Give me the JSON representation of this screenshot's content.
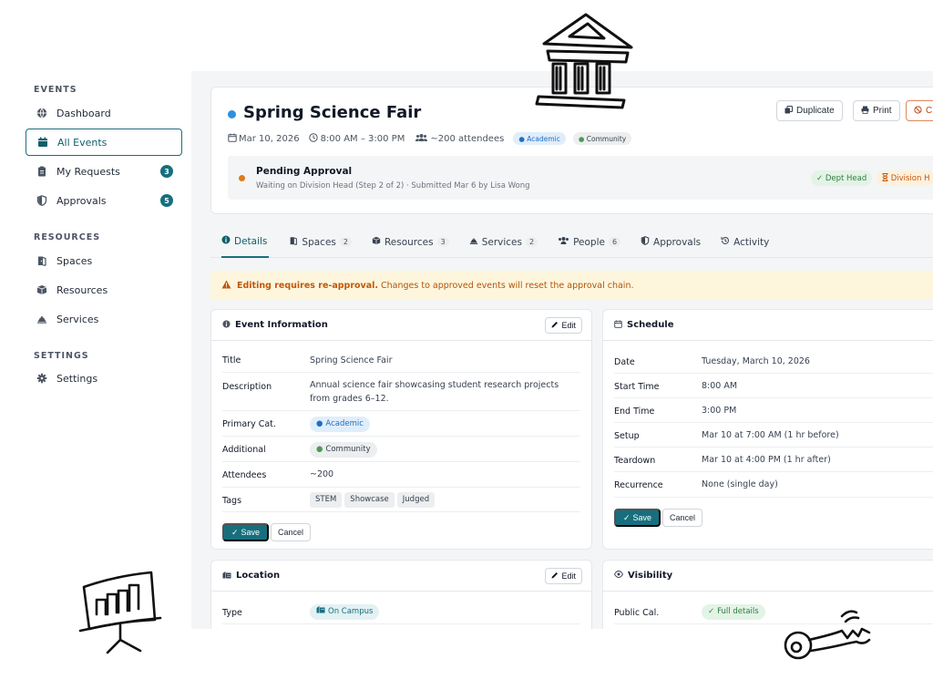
{
  "sidebar": {
    "sections": [
      {
        "title": "EVENTS"
      },
      {
        "title": "RESOURCES"
      },
      {
        "title": "SETTINGS"
      }
    ],
    "items": [
      {
        "label": "Dashboard",
        "icon": "globe-icon"
      },
      {
        "label": "All Events",
        "icon": "calendar-icon",
        "active": true
      },
      {
        "label": "My Requests",
        "icon": "clipboard-icon",
        "badge": "3"
      },
      {
        "label": "Approvals",
        "icon": "shield-icon",
        "badge": "5"
      },
      {
        "label": "Spaces",
        "icon": "door-icon"
      },
      {
        "label": "Resources",
        "icon": "box-icon"
      },
      {
        "label": "Services",
        "icon": "bell-icon"
      },
      {
        "label": "Settings",
        "icon": "gear-icon"
      }
    ]
  },
  "event": {
    "title": "Spring Science Fair",
    "date": "Mar 10, 2026",
    "time": "8:00 AM – 3:00 PM",
    "attendees": "~200 attendees",
    "primary_cat": "Academic",
    "additional_cat": "Community"
  },
  "actions": {
    "duplicate": "Duplicate",
    "print": "Print",
    "cancel_partial": "C"
  },
  "status": {
    "title": "Pending Approval",
    "subtitle": "Waiting on Division Head (Step 2 of 2) · Submitted Mar 6 by Lisa Wong",
    "step1": "Dept Head",
    "step2": "Division H"
  },
  "tabs": [
    {
      "label": "Details",
      "icon": "info-icon"
    },
    {
      "label": "Spaces",
      "count": "2",
      "icon": "door-icon"
    },
    {
      "label": "Resources",
      "count": "3",
      "icon": "box-icon"
    },
    {
      "label": "Services",
      "count": "2",
      "icon": "bell-icon"
    },
    {
      "label": "People",
      "count": "6",
      "icon": "people-icon"
    },
    {
      "label": "Approvals",
      "icon": "shield-icon"
    },
    {
      "label": "Activity",
      "icon": "history-icon"
    }
  ],
  "warning": {
    "bold": "Editing requires re-approval.",
    "text": "Changes to approved events will reset the approval chain."
  },
  "event_info": {
    "heading": "Event Information",
    "edit": "Edit",
    "rows": [
      {
        "k": "Title",
        "v": "Spring Science Fair"
      },
      {
        "k": "Description",
        "v": "Annual science fair showcasing student research projects from grades 6–12."
      },
      {
        "k": "Primary Cat.",
        "v": "Academic"
      },
      {
        "k": "Additional",
        "v": "Community"
      },
      {
        "k": "Attendees",
        "v": "~200"
      },
      {
        "k": "Tags",
        "v": ""
      }
    ],
    "tags": [
      "STEM",
      "Showcase",
      "Judged"
    ],
    "save": "Save",
    "cancel": "Cancel"
  },
  "schedule": {
    "heading": "Schedule",
    "rows": [
      {
        "k": "Date",
        "v": "Tuesday, March 10, 2026"
      },
      {
        "k": "Start Time",
        "v": "8:00 AM"
      },
      {
        "k": "End Time",
        "v": "3:00 PM"
      },
      {
        "k": "Setup",
        "v": "Mar 10 at 7:00 AM (1 hr before)"
      },
      {
        "k": "Teardown",
        "v": "Mar 10 at 4:00 PM (1 hr after)"
      },
      {
        "k": "Recurrence",
        "v": "None (single day)"
      }
    ],
    "save": "Save",
    "cancel": "Cancel"
  },
  "location": {
    "heading": "Location",
    "edit": "Edit",
    "type_label": "Type",
    "type_value": "On Campus"
  },
  "visibility": {
    "heading": "Visibility",
    "public_label": "Public Cal.",
    "public_value": "Full details"
  },
  "colors": {
    "accent": "#176f7e",
    "blue_dot": "#2f8fdf",
    "pending": "#e07b18",
    "warning_bg": "#fdf6dd"
  }
}
